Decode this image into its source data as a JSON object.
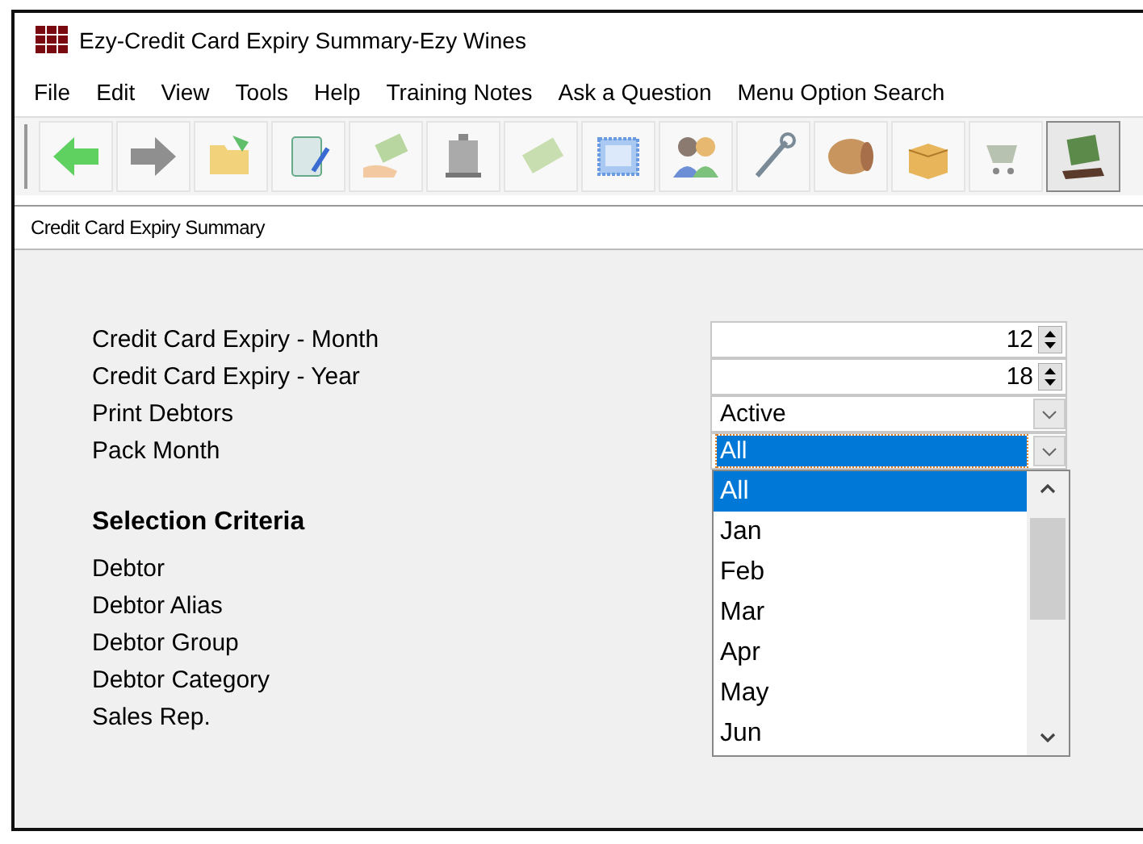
{
  "window": {
    "title": "Ezy-Credit Card Expiry Summary-Ezy Wines"
  },
  "menu": [
    "File",
    "Edit",
    "View",
    "Tools",
    "Help",
    "Training Notes",
    "Ask a Question",
    "Menu Option Search"
  ],
  "tab": {
    "label": "Credit Card Expiry Summary"
  },
  "fields": [
    {
      "label": "Credit Card Expiry - Month",
      "kind": "spin",
      "value": "12"
    },
    {
      "label": "Credit Card Expiry - Year",
      "kind": "spin",
      "value": "18"
    },
    {
      "label": "Print Debtors",
      "kind": "combo",
      "value": "Active",
      "focused": false
    },
    {
      "label": "Pack Month",
      "kind": "combo",
      "value": "All",
      "focused": true
    }
  ],
  "section": {
    "title": "Selection Criteria",
    "items": [
      "Debtor",
      "Debtor Alias",
      "Debtor Group",
      "Debtor Category",
      "Sales Rep."
    ]
  },
  "dropdown": {
    "options": [
      {
        "label": "All",
        "selected": true
      },
      {
        "label": "Jan",
        "selected": false
      },
      {
        "label": "Feb",
        "selected": false
      },
      {
        "label": "Mar",
        "selected": false
      },
      {
        "label": "Apr",
        "selected": false
      },
      {
        "label": "May",
        "selected": false
      },
      {
        "label": "Jun",
        "selected": false
      }
    ]
  }
}
